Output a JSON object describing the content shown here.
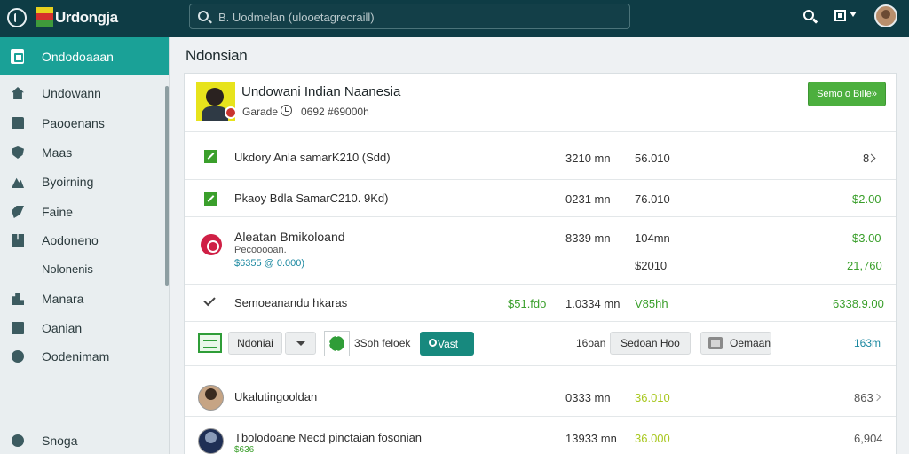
{
  "app": {
    "brand": "Urdongja",
    "flag_colors": [
      "#e7d11f",
      "#d6302c",
      "#3f9b3b"
    ]
  },
  "search": {
    "placeholder": "B. Uodmelan (ulooetagrecraill)"
  },
  "sidebar": {
    "active": {
      "label": "Ondodoaaan",
      "icon": "document-icon"
    },
    "items": [
      {
        "label": "Undowann",
        "icon": "home-icon"
      },
      {
        "label": "Paooenans",
        "icon": "box-icon"
      },
      {
        "label": "Maas",
        "icon": "shield-icon"
      },
      {
        "label": "Byoirning",
        "icon": "mountain-icon"
      },
      {
        "label": "Faine",
        "icon": "leaf-icon"
      },
      {
        "label": "Aodoneno",
        "icon": "grid-icon"
      },
      {
        "label": "Nolonenis",
        "icon": ""
      },
      {
        "label": "Manara",
        "icon": "chart-icon"
      },
      {
        "label": "Oanian",
        "icon": "doc-icon"
      },
      {
        "label": "Oodenimam",
        "icon": "circle-icon"
      }
    ],
    "footer": {
      "label": "Snoga",
      "icon": "settings-icon"
    }
  },
  "page": {
    "title": "Ndonsian"
  },
  "profile": {
    "name": "Undowani Indian Naanesia",
    "meta_label": "Garade",
    "meta_value": "0692 #69000h",
    "button": "Semo o Bille»"
  },
  "rows": [
    {
      "label": "Ukdory Anla samarK210 (Sdd)",
      "time": "3210 mn",
      "amount": "56.010",
      "end": "8"
    },
    {
      "label": "Pkaoy Bdla SamarC210. 9Kd)",
      "time": "0231 mn",
      "amount": "76.010",
      "end": "$2.00"
    },
    {
      "title": "Aleatan Bmikoloand",
      "subtitle": "Pecooooan.",
      "link": "$6355 @ 0.000)",
      "time": "8339 mn",
      "amount": "104mn",
      "amount2": "$2010",
      "end": "$3.00",
      "end2": "21,760"
    },
    {
      "label": "Semoeanandu hkaras",
      "mid": "$51.fdo",
      "time": "1.0334 mn",
      "amount": "V85hh",
      "end": "6338.9.00"
    }
  ],
  "toolbar": {
    "button1": "Ndoniai",
    "label": "3Soh feloek",
    "visit": "Vast",
    "time": "16oan",
    "button2": "Sedoan Hoo",
    "button3": "Oemaan",
    "end": "163m"
  },
  "list": [
    {
      "name": "Ukalutingooldan",
      "time": "0333 mn",
      "amount": "36.010",
      "end": "863"
    },
    {
      "name": "Tbolodoane Necd pinctaian fosonian",
      "time": "13933 mn",
      "amount": "36.000",
      "end": "6,904",
      "sub": "$636"
    }
  ]
}
